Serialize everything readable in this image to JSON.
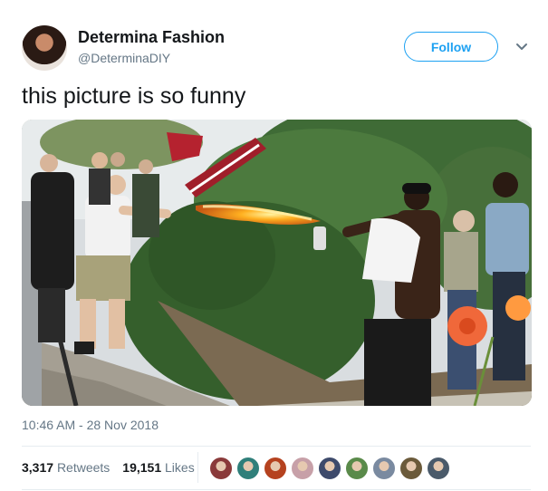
{
  "author": {
    "display_name": "Determina Fashion",
    "handle": "@DeterminaDIY"
  },
  "actions": {
    "follow_label": "Follow",
    "menu_icon": "chevron-down-icon"
  },
  "tweet": {
    "text": "this picture is so funny",
    "timestamp": "10:46 AM - 28 Nov 2018"
  },
  "stats": {
    "retweets_count": "3,317",
    "retweets_label": "Retweets",
    "likes_count": "19,151",
    "likes_label": "Likes"
  },
  "likers": [
    {
      "color": "#8a3a3a"
    },
    {
      "color": "#2f7f7a"
    },
    {
      "color": "#b5421f"
    },
    {
      "color": "#c7a0a8"
    },
    {
      "color": "#3d4a6b"
    },
    {
      "color": "#5a8a4a"
    },
    {
      "color": "#7a8aa0"
    },
    {
      "color": "#6b5a3a"
    },
    {
      "color": "#4a5a6a"
    }
  ],
  "colors": {
    "accent": "#1da1f2",
    "secondary_text": "#657786"
  }
}
